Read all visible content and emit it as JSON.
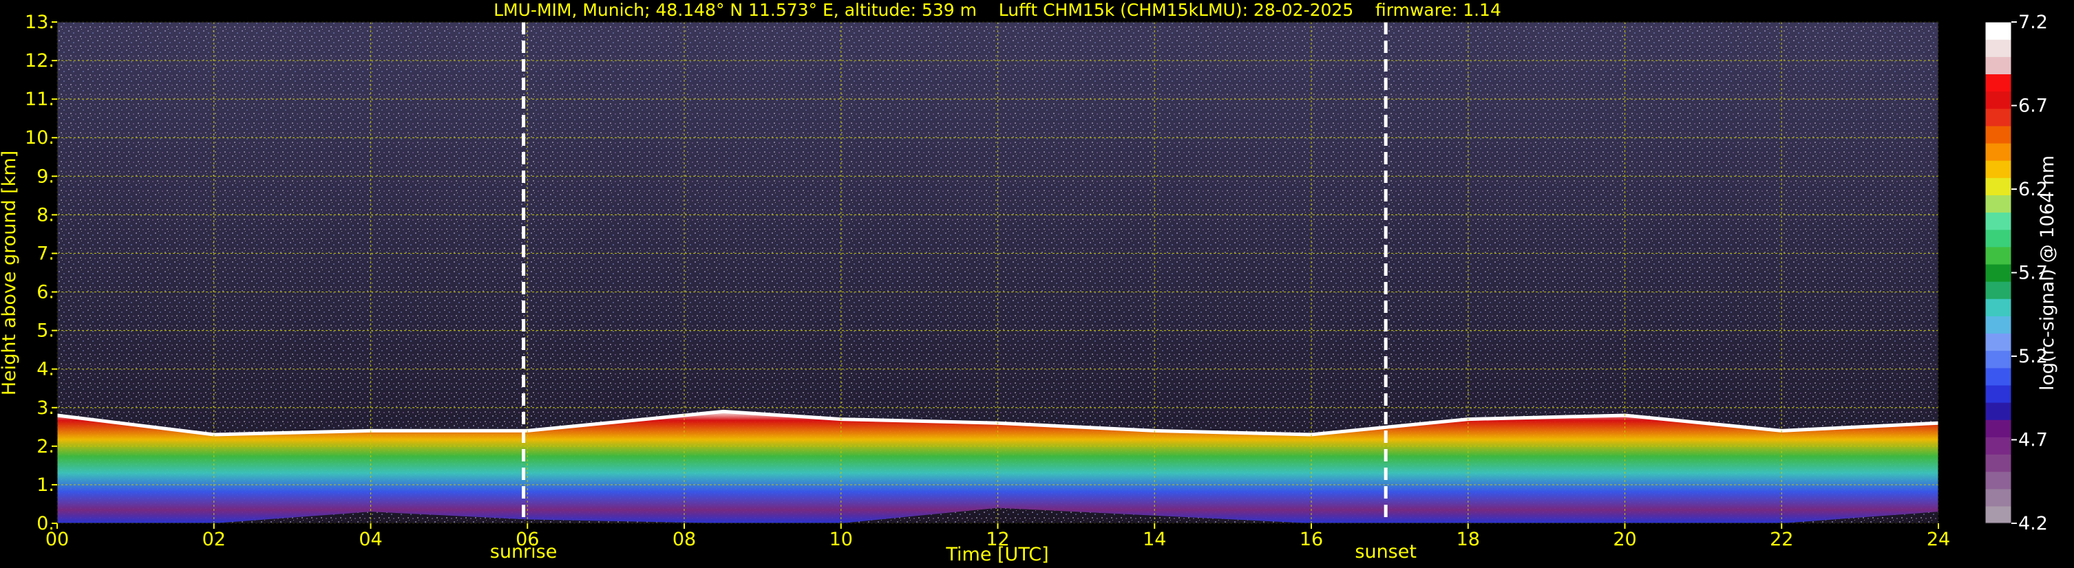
{
  "chart_data": {
    "type": "heatmap",
    "title": "LMU-MIM, Munich; 48.148° N 11.573° E, altitude: 539 m    Lufft CHM15k (CHM15kLMU): 28-02-2025    firmware: 1.14",
    "xlabel": "Time [UTC]",
    "ylabel": "Height above ground [km]",
    "xlim": [
      0,
      24
    ],
    "ylim": [
      0,
      13
    ],
    "x_ticks": [
      "00",
      "02",
      "04",
      "06",
      "08",
      "10",
      "12",
      "14",
      "16",
      "18",
      "20",
      "22",
      "24"
    ],
    "y_ticks": [
      "0.",
      "1.",
      "2.",
      "3.",
      "4.",
      "5.",
      "6.",
      "7.",
      "8.",
      "9.",
      "10.",
      "11.",
      "12.",
      "13."
    ],
    "grid": true,
    "annotations": [
      {
        "label": "sunrise",
        "x": 5.95
      },
      {
        "label": "sunset",
        "x": 16.95
      }
    ],
    "colorbar": {
      "label": "log(rc-signal) @ 1064 nm",
      "range": [
        4.2,
        7.2
      ],
      "ticks": [
        "4.2",
        "4.7",
        "5.2",
        "5.7",
        "6.2",
        "6.7",
        "7.2"
      ],
      "colors": [
        "#a89aaa",
        "#9a7fa0",
        "#8e6296",
        "#83438a",
        "#7a2a86",
        "#6a1480",
        "#2a1aa8",
        "#2a34d8",
        "#3a58f0",
        "#5a7cf4",
        "#7a9cf6",
        "#5ab8e4",
        "#3ec8c0",
        "#22aa66",
        "#129628",
        "#40c040",
        "#3ad07a",
        "#58e0a0",
        "#aae060",
        "#e8e820",
        "#f8c000",
        "#f89000",
        "#f06000",
        "#e83018",
        "#e01010",
        "#f81010",
        "#e8c0c4",
        "#f0e0e0",
        "#ffffff"
      ]
    },
    "cloud_layer": {
      "description_units": "km",
      "points": [
        {
          "x": 0.0,
          "base": 0.0,
          "top": 2.8
        },
        {
          "x": 2.0,
          "base": 0.0,
          "top": 2.3
        },
        {
          "x": 4.0,
          "base": 0.3,
          "top": 2.4
        },
        {
          "x": 6.0,
          "base": 0.1,
          "top": 2.4
        },
        {
          "x": 8.5,
          "base": 0.0,
          "top": 2.9
        },
        {
          "x": 10.0,
          "base": 0.0,
          "top": 2.7
        },
        {
          "x": 12.0,
          "base": 0.4,
          "top": 2.6
        },
        {
          "x": 14.0,
          "base": 0.2,
          "top": 2.4
        },
        {
          "x": 16.0,
          "base": 0.0,
          "top": 2.3
        },
        {
          "x": 18.0,
          "base": 0.0,
          "top": 2.7
        },
        {
          "x": 20.0,
          "base": 0.0,
          "top": 2.8
        },
        {
          "x": 22.0,
          "base": 0.0,
          "top": 2.4
        },
        {
          "x": 24.0,
          "base": 0.3,
          "top": 2.6
        }
      ]
    }
  }
}
